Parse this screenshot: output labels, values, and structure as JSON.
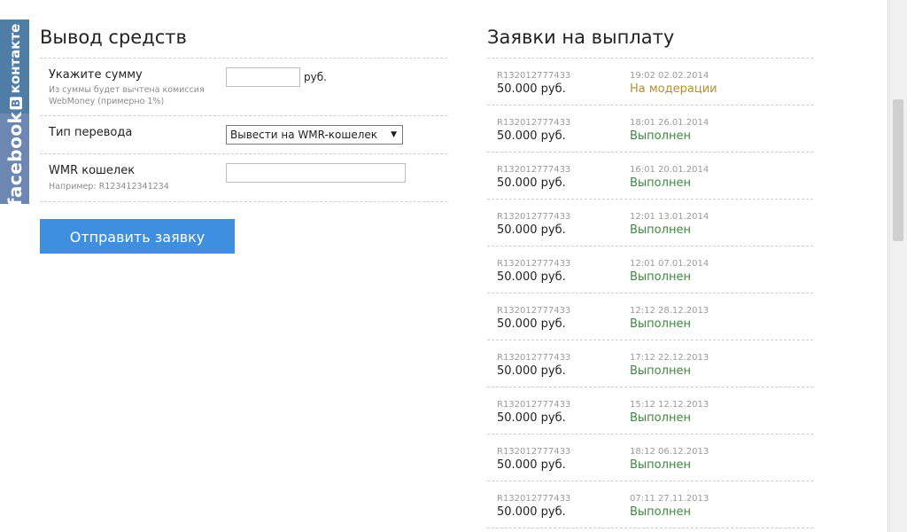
{
  "social": {
    "vk_label": "контакте",
    "vk_letter": "В",
    "fb_label": "facebook"
  },
  "withdraw": {
    "title": "Вывод средств",
    "amount_label": "Укажите сумму",
    "amount_hint": "Из суммы будет вычтена комиссия WebMoney (примерно 1%)",
    "amount_value": "",
    "amount_unit": "руб.",
    "type_label": "Тип перевода",
    "type_selected": "Вывести на WMR-кошелек",
    "wallet_label": "WMR кошелек",
    "wallet_hint": "Например: R123412341234",
    "wallet_value": "",
    "submit_label": "Отправить заявку"
  },
  "requests": {
    "title": "Заявки на выплату",
    "items": [
      {
        "account": "R132012777433",
        "amount": "50.000 руб.",
        "datetime": "19:02 02.02.2014",
        "status": "На модерации",
        "status_type": "mod"
      },
      {
        "account": "R132012777433",
        "amount": "50.000 руб.",
        "datetime": "18:01 26.01.2014",
        "status": "Выполнен",
        "status_type": "done"
      },
      {
        "account": "R132012777433",
        "amount": "50.000 руб.",
        "datetime": "16:01 20.01.2014",
        "status": "Выполнен",
        "status_type": "done"
      },
      {
        "account": "R132012777433",
        "amount": "50.000 руб.",
        "datetime": "12:01 13.01.2014",
        "status": "Выполнен",
        "status_type": "done"
      },
      {
        "account": "R132012777433",
        "amount": "50.000 руб.",
        "datetime": "12:01 07.01.2014",
        "status": "Выполнен",
        "status_type": "done"
      },
      {
        "account": "R132012777433",
        "amount": "50.000 руб.",
        "datetime": "12:12 28.12.2013",
        "status": "Выполнен",
        "status_type": "done"
      },
      {
        "account": "R132012777433",
        "amount": "50.000 руб.",
        "datetime": "17:12 22.12.2013",
        "status": "Выполнен",
        "status_type": "done"
      },
      {
        "account": "R132012777433",
        "amount": "50.000 руб.",
        "datetime": "15:12 12.12.2013",
        "status": "Выполнен",
        "status_type": "done"
      },
      {
        "account": "R132012777433",
        "amount": "50.000 руб.",
        "datetime": "18:12 06.12.2013",
        "status": "Выполнен",
        "status_type": "done"
      },
      {
        "account": "R132012777433",
        "amount": "50.000 руб.",
        "datetime": "07:11 27.11.2013",
        "status": "Выполнен",
        "status_type": "done"
      }
    ]
  },
  "colors": {
    "button": "#3e8fe0",
    "status_done": "#3c8a3e",
    "status_moderation": "#b88f2e",
    "vk": "#507da6",
    "facebook": "#6d87b3"
  }
}
